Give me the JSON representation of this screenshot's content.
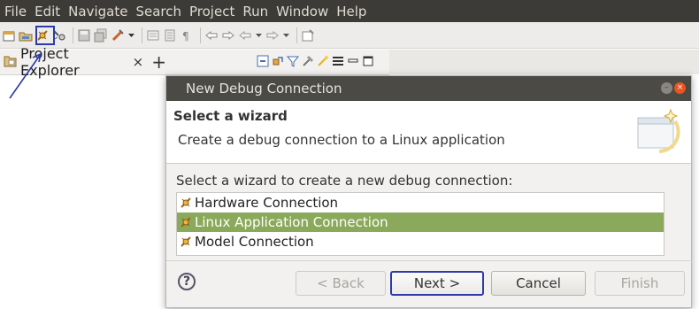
{
  "menubar": {
    "items": [
      "File",
      "Edit",
      "Navigate",
      "Search",
      "Project",
      "Run",
      "Window",
      "Help"
    ]
  },
  "toolbar": {
    "icons": [
      "new-icon",
      "open-icon",
      "new-debug-connection-icon",
      "debug-tools-icon",
      "save-icon",
      "save-all-icon",
      "run-icon",
      "dropdown-icon",
      "toggle-icon",
      "block-icon",
      "pilcrow-icon",
      "back-icon",
      "forward-icon",
      "nav-back-icon",
      "nav-forward-icon",
      "pin-icon"
    ]
  },
  "explorer": {
    "tab_label": "Project Explorer",
    "close_glyph": "×",
    "add_glyph": "+"
  },
  "dialog": {
    "title": "New Debug Connection",
    "header_title": "Select a wizard",
    "header_description": "Create a debug connection to a Linux application",
    "prompt": "Select a wizard to create a new debug connection:",
    "wizards": [
      {
        "label": "Hardware Connection",
        "selected": false
      },
      {
        "label": "Linux Application Connection",
        "selected": true
      },
      {
        "label": "Model Connection",
        "selected": false
      }
    ],
    "buttons": {
      "help": "?",
      "back": "< Back",
      "next": "Next >",
      "cancel": "Cancel",
      "finish": "Finish"
    }
  },
  "colors": {
    "menubar_bg": "#3c3b37",
    "selection": "#8aa95a",
    "annotation": "#2e3aa8",
    "close_button": "#e95420"
  }
}
